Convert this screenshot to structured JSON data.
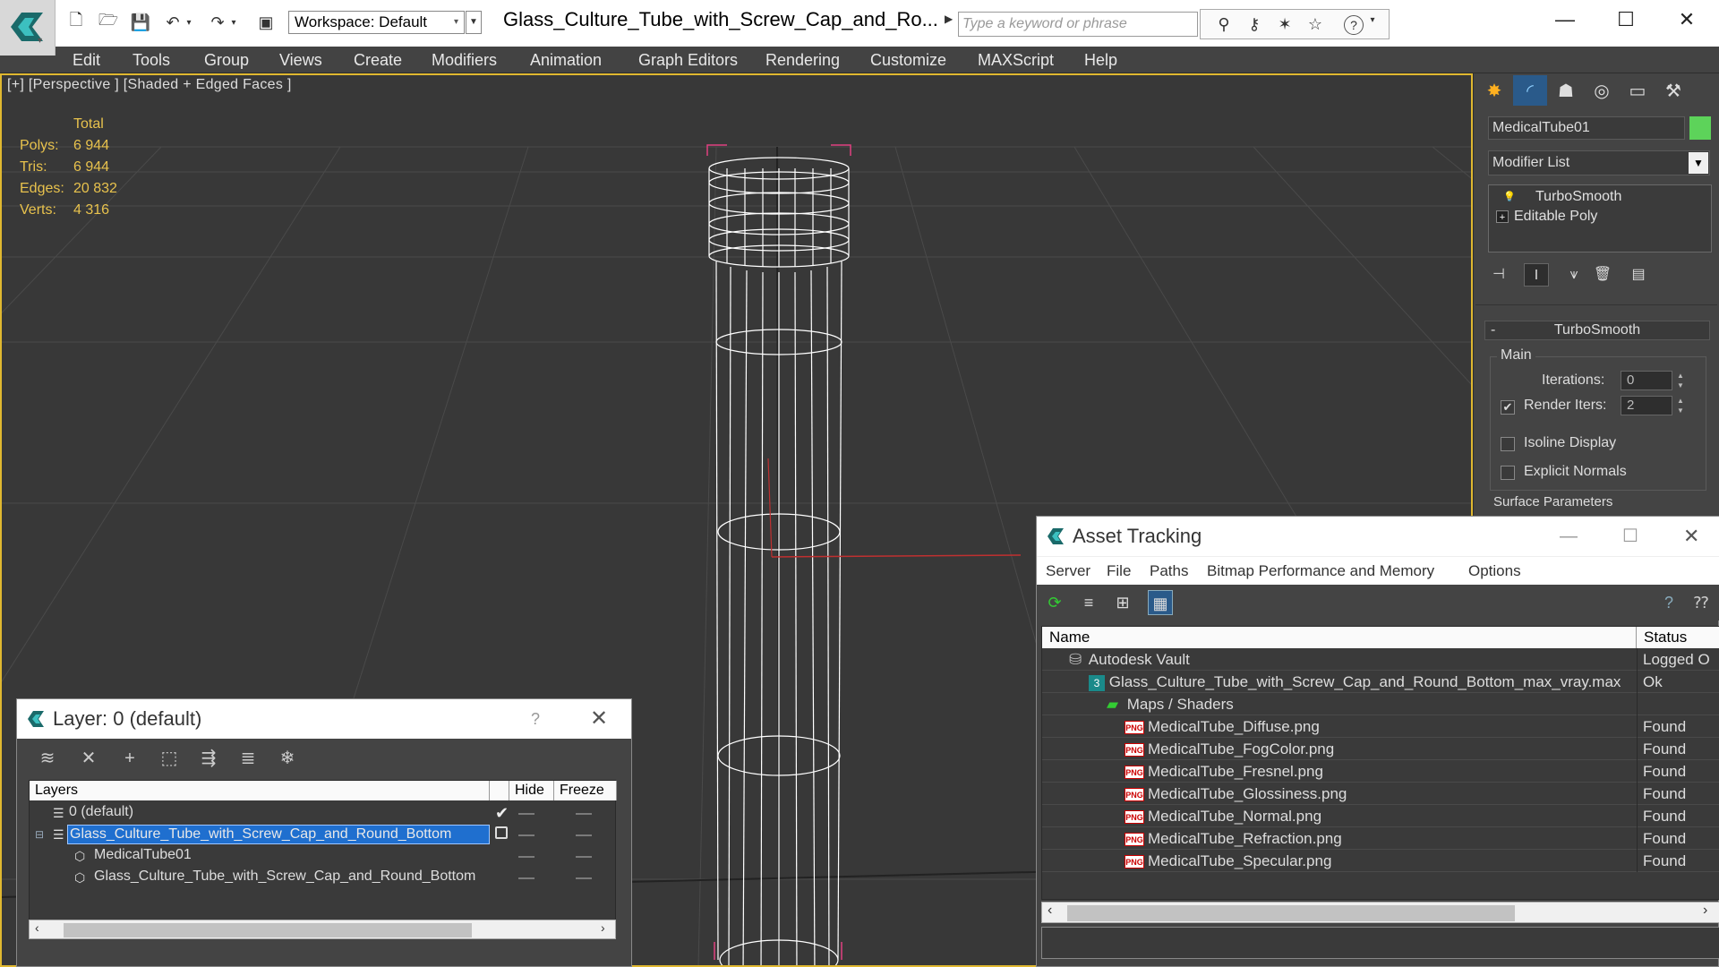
{
  "window": {
    "title": "Glass_Culture_Tube_with_Screw_Cap_and_Ro...",
    "workspace": "Workspace: Default",
    "search_placeholder": "Type a keyword or phrase"
  },
  "menubar": [
    "Edit",
    "Tools",
    "Group",
    "Views",
    "Create",
    "Modifiers",
    "Animation",
    "Graph Editors",
    "Rendering",
    "Customize",
    "MAXScript",
    "Help"
  ],
  "viewport": {
    "label": "[+] [Perspective ] [Shaded + Edged Faces ]",
    "stats": {
      "header": "Total",
      "rows": [
        {
          "label": "Polys:",
          "value": "6 944"
        },
        {
          "label": "Tris:",
          "value": "6 944"
        },
        {
          "label": "Edges:",
          "value": "20 832"
        },
        {
          "label": "Verts:",
          "value": "4 316"
        }
      ]
    }
  },
  "command_panel": {
    "object_name": "MedicalTube01",
    "object_color": "#5dd35a",
    "modifier_list": "Modifier List",
    "stack": [
      "TurboSmooth",
      "Editable Poly"
    ],
    "rollout": "TurboSmooth",
    "group_main": "Main",
    "iterations_label": "Iterations:",
    "iterations_value": "0",
    "render_iters_label": "Render Iters:",
    "render_iters_value": "2",
    "isoline_label": "Isoline Display",
    "explicit_normals_label": "Explicit Normals",
    "surface_params": "Surface Parameters"
  },
  "layer_dialog": {
    "title": "Layer: 0 (default)",
    "help": "?",
    "columns": [
      "Layers",
      "Hide",
      "Freeze"
    ],
    "rows": [
      {
        "name": "0 (default)"
      },
      {
        "name": "Glass_Culture_Tube_with_Screw_Cap_and_Round_Bottom"
      },
      {
        "name": "MedicalTube01"
      },
      {
        "name": "Glass_Culture_Tube_with_Screw_Cap_and_Round_Bottom"
      }
    ]
  },
  "asset_dialog": {
    "title": "Asset Tracking",
    "menu": [
      "Server",
      "File",
      "Paths",
      "Bitmap Performance and Memory",
      "Options"
    ],
    "columns": [
      "Name",
      "Status"
    ],
    "rows": [
      {
        "name": "Autodesk Vault",
        "status": "Logged O"
      },
      {
        "name": "Glass_Culture_Tube_with_Screw_Cap_and_Round_Bottom_max_vray.max",
        "status": "Ok"
      },
      {
        "name": "Maps / Shaders",
        "status": ""
      },
      {
        "name": "MedicalTube_Diffuse.png",
        "status": "Found"
      },
      {
        "name": "MedicalTube_FogColor.png",
        "status": "Found"
      },
      {
        "name": "MedicalTube_Fresnel.png",
        "status": "Found"
      },
      {
        "name": "MedicalTube_Glossiness.png",
        "status": "Found"
      },
      {
        "name": "MedicalTube_Normal.png",
        "status": "Found"
      },
      {
        "name": "MedicalTube_Refraction.png",
        "status": "Found"
      },
      {
        "name": "MedicalTube_Specular.png",
        "status": "Found"
      }
    ],
    "png_badge": "PNG",
    "max_badge": "3"
  }
}
